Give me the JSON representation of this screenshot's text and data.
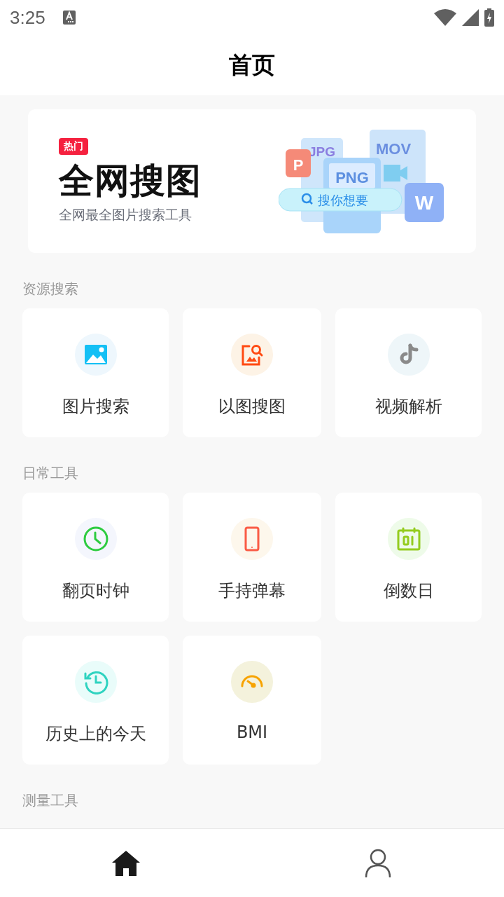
{
  "status_bar": {
    "time": "3:25"
  },
  "header": {
    "title": "首页"
  },
  "banner": {
    "badge": "热门",
    "title": "全网搜图",
    "subtitle": "全网最全图片搜索工具",
    "illustration": {
      "tags": [
        "JPG",
        "MOV",
        "PNG",
        "P",
        "W"
      ],
      "search_text": "搜你想要"
    }
  },
  "sections": [
    {
      "title": "资源搜索",
      "tools": [
        {
          "label": "图片搜索",
          "kind": "image",
          "color": "#14c0f5"
        },
        {
          "label": "以图搜图",
          "kind": "image-search",
          "color": "#ff4a12"
        },
        {
          "label": "视频解析",
          "kind": "music-note",
          "color": "#8a8a8a"
        }
      ]
    },
    {
      "title": "日常工具",
      "tools": [
        {
          "label": "翻页时钟",
          "kind": "clock",
          "color": "#2ecc40"
        },
        {
          "label": "手持弹幕",
          "kind": "phone",
          "color": "#fa5b45"
        },
        {
          "label": "倒数日",
          "kind": "calendar",
          "color": "#94cc1e"
        },
        {
          "label": "历史上的今天",
          "kind": "history",
          "color": "#2fd3c0"
        },
        {
          "label": "BMI",
          "kind": "gauge",
          "color": "#f7a300"
        }
      ]
    },
    {
      "title": "测量工具"
    }
  ],
  "bottom_nav": [
    {
      "kind": "home",
      "selected": true
    },
    {
      "kind": "profile",
      "selected": false
    }
  ]
}
